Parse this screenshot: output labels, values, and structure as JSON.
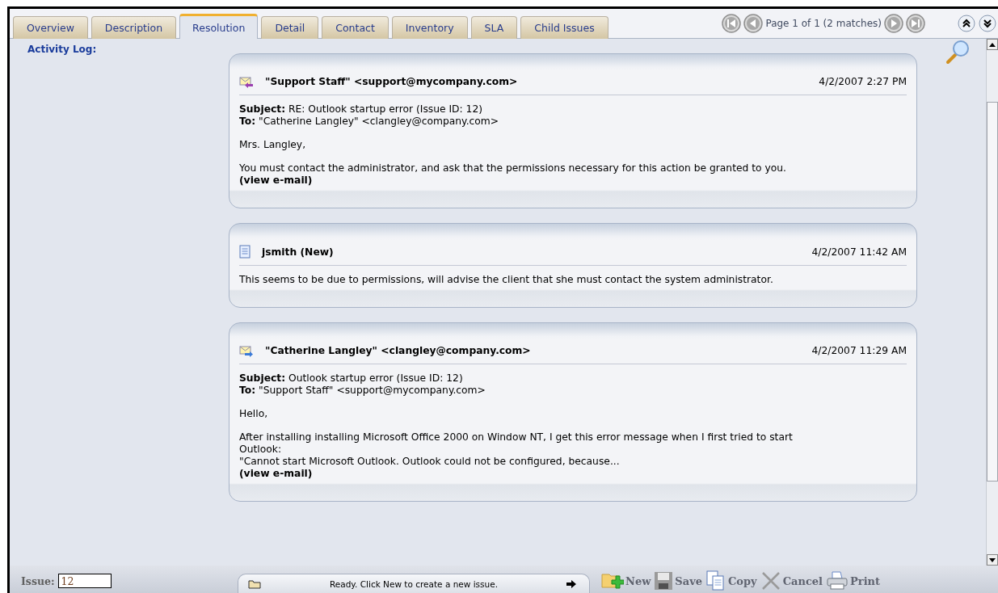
{
  "tabs": [
    {
      "label": "Overview",
      "selected": false
    },
    {
      "label": "Description",
      "selected": false
    },
    {
      "label": "Resolution",
      "selected": true
    },
    {
      "label": "Detail",
      "selected": false
    },
    {
      "label": "Contact",
      "selected": false
    },
    {
      "label": "Inventory",
      "selected": false
    },
    {
      "label": "SLA",
      "selected": false
    },
    {
      "label": "Child Issues",
      "selected": false
    }
  ],
  "pager": {
    "text": "Page 1 of 1 (2 matches)"
  },
  "section_label": "Activity Log:",
  "entries": [
    {
      "kind": "email_reply",
      "sender": "\"Support Staff\" <support@mycompany.com>",
      "date": "4/2/2007 2:27 PM",
      "fields": [
        "**Subject:** RE: Outlook startup error (Issue ID: 12)",
        "**To:** \"Catherine Langley\" <clangley@company.com>"
      ],
      "paragraphs": [
        [
          "Mrs. Langley,"
        ],
        [
          "You must contact the administrator, and ask that the permissions necessary for this action be granted to you."
        ]
      ],
      "link": "(view e-mail)"
    },
    {
      "kind": "note",
      "sender": "jsmith (New)",
      "date": "4/2/2007 11:42 AM",
      "paragraphs": [
        [
          "This seems to be due to permissions, will advise the client that she must contact the system administrator."
        ]
      ]
    },
    {
      "kind": "email_in",
      "sender": "\"Catherine Langley\" <clangley@company.com>",
      "date": "4/2/2007 11:29 AM",
      "fields": [
        "**Subject:** Outlook startup error (Issue ID: 12)",
        "**To:** \"Support Staff\" <support@mycompany.com>"
      ],
      "paragraphs": [
        [
          "Hello,"
        ],
        [
          "After installing installing Microsoft Office 2000 on Window NT, I get this error message when I first tried to start",
          "Outlook:",
          "\"Cannot start Microsoft Outlook. Outlook could not be configured, because..."
        ]
      ],
      "link": "(view e-mail)"
    }
  ],
  "issue": {
    "label": "Issue:",
    "value": "12"
  },
  "status": {
    "text": "Ready. Click New to create a new issue."
  },
  "toolbar": [
    {
      "kind": "new",
      "label": "New"
    },
    {
      "kind": "save",
      "label": "Save"
    },
    {
      "kind": "copy",
      "label": "Copy"
    },
    {
      "kind": "cancel",
      "label": "Cancel"
    },
    {
      "kind": "print",
      "label": "Print"
    }
  ]
}
